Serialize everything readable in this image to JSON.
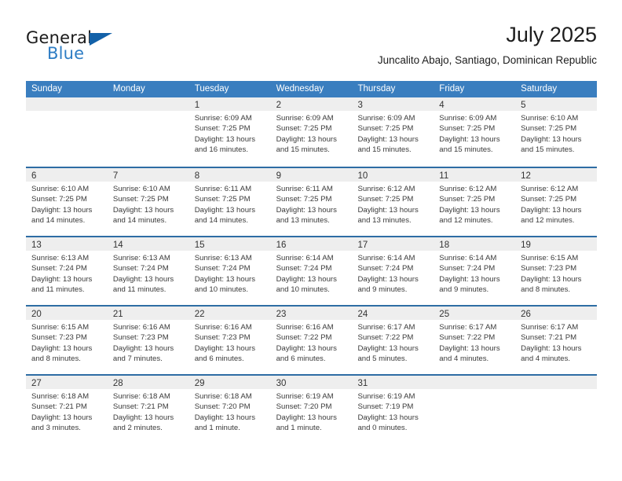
{
  "brand": {
    "name_part1": "General",
    "name_part2": "Blue",
    "flag_icon": "triangle-flag-icon"
  },
  "header": {
    "month_title": "July 2025",
    "location": "Juncalito Abajo, Santiago, Dominican Republic"
  },
  "colors": {
    "header_blue": "#3a7ebf",
    "week_divider_blue": "#2e6da4",
    "daynum_band": "#eeeeee",
    "brand_blue": "#2e7dc4",
    "flag_blue": "#1361a8"
  },
  "weekdays": [
    "Sunday",
    "Monday",
    "Tuesday",
    "Wednesday",
    "Thursday",
    "Friday",
    "Saturday"
  ],
  "weeks": [
    [
      {
        "day": "",
        "sunrise": "",
        "sunset": "",
        "daylight_line1": "",
        "daylight_line2": ""
      },
      {
        "day": "",
        "sunrise": "",
        "sunset": "",
        "daylight_line1": "",
        "daylight_line2": ""
      },
      {
        "day": "1",
        "sunrise": "Sunrise: 6:09 AM",
        "sunset": "Sunset: 7:25 PM",
        "daylight_line1": "Daylight: 13 hours",
        "daylight_line2": "and 16 minutes."
      },
      {
        "day": "2",
        "sunrise": "Sunrise: 6:09 AM",
        "sunset": "Sunset: 7:25 PM",
        "daylight_line1": "Daylight: 13 hours",
        "daylight_line2": "and 15 minutes."
      },
      {
        "day": "3",
        "sunrise": "Sunrise: 6:09 AM",
        "sunset": "Sunset: 7:25 PM",
        "daylight_line1": "Daylight: 13 hours",
        "daylight_line2": "and 15 minutes."
      },
      {
        "day": "4",
        "sunrise": "Sunrise: 6:09 AM",
        "sunset": "Sunset: 7:25 PM",
        "daylight_line1": "Daylight: 13 hours",
        "daylight_line2": "and 15 minutes."
      },
      {
        "day": "5",
        "sunrise": "Sunrise: 6:10 AM",
        "sunset": "Sunset: 7:25 PM",
        "daylight_line1": "Daylight: 13 hours",
        "daylight_line2": "and 15 minutes."
      }
    ],
    [
      {
        "day": "6",
        "sunrise": "Sunrise: 6:10 AM",
        "sunset": "Sunset: 7:25 PM",
        "daylight_line1": "Daylight: 13 hours",
        "daylight_line2": "and 14 minutes."
      },
      {
        "day": "7",
        "sunrise": "Sunrise: 6:10 AM",
        "sunset": "Sunset: 7:25 PM",
        "daylight_line1": "Daylight: 13 hours",
        "daylight_line2": "and 14 minutes."
      },
      {
        "day": "8",
        "sunrise": "Sunrise: 6:11 AM",
        "sunset": "Sunset: 7:25 PM",
        "daylight_line1": "Daylight: 13 hours",
        "daylight_line2": "and 14 minutes."
      },
      {
        "day": "9",
        "sunrise": "Sunrise: 6:11 AM",
        "sunset": "Sunset: 7:25 PM",
        "daylight_line1": "Daylight: 13 hours",
        "daylight_line2": "and 13 minutes."
      },
      {
        "day": "10",
        "sunrise": "Sunrise: 6:12 AM",
        "sunset": "Sunset: 7:25 PM",
        "daylight_line1": "Daylight: 13 hours",
        "daylight_line2": "and 13 minutes."
      },
      {
        "day": "11",
        "sunrise": "Sunrise: 6:12 AM",
        "sunset": "Sunset: 7:25 PM",
        "daylight_line1": "Daylight: 13 hours",
        "daylight_line2": "and 12 minutes."
      },
      {
        "day": "12",
        "sunrise": "Sunrise: 6:12 AM",
        "sunset": "Sunset: 7:25 PM",
        "daylight_line1": "Daylight: 13 hours",
        "daylight_line2": "and 12 minutes."
      }
    ],
    [
      {
        "day": "13",
        "sunrise": "Sunrise: 6:13 AM",
        "sunset": "Sunset: 7:24 PM",
        "daylight_line1": "Daylight: 13 hours",
        "daylight_line2": "and 11 minutes."
      },
      {
        "day": "14",
        "sunrise": "Sunrise: 6:13 AM",
        "sunset": "Sunset: 7:24 PM",
        "daylight_line1": "Daylight: 13 hours",
        "daylight_line2": "and 11 minutes."
      },
      {
        "day": "15",
        "sunrise": "Sunrise: 6:13 AM",
        "sunset": "Sunset: 7:24 PM",
        "daylight_line1": "Daylight: 13 hours",
        "daylight_line2": "and 10 minutes."
      },
      {
        "day": "16",
        "sunrise": "Sunrise: 6:14 AM",
        "sunset": "Sunset: 7:24 PM",
        "daylight_line1": "Daylight: 13 hours",
        "daylight_line2": "and 10 minutes."
      },
      {
        "day": "17",
        "sunrise": "Sunrise: 6:14 AM",
        "sunset": "Sunset: 7:24 PM",
        "daylight_line1": "Daylight: 13 hours",
        "daylight_line2": "and 9 minutes."
      },
      {
        "day": "18",
        "sunrise": "Sunrise: 6:14 AM",
        "sunset": "Sunset: 7:24 PM",
        "daylight_line1": "Daylight: 13 hours",
        "daylight_line2": "and 9 minutes."
      },
      {
        "day": "19",
        "sunrise": "Sunrise: 6:15 AM",
        "sunset": "Sunset: 7:23 PM",
        "daylight_line1": "Daylight: 13 hours",
        "daylight_line2": "and 8 minutes."
      }
    ],
    [
      {
        "day": "20",
        "sunrise": "Sunrise: 6:15 AM",
        "sunset": "Sunset: 7:23 PM",
        "daylight_line1": "Daylight: 13 hours",
        "daylight_line2": "and 8 minutes."
      },
      {
        "day": "21",
        "sunrise": "Sunrise: 6:16 AM",
        "sunset": "Sunset: 7:23 PM",
        "daylight_line1": "Daylight: 13 hours",
        "daylight_line2": "and 7 minutes."
      },
      {
        "day": "22",
        "sunrise": "Sunrise: 6:16 AM",
        "sunset": "Sunset: 7:23 PM",
        "daylight_line1": "Daylight: 13 hours",
        "daylight_line2": "and 6 minutes."
      },
      {
        "day": "23",
        "sunrise": "Sunrise: 6:16 AM",
        "sunset": "Sunset: 7:22 PM",
        "daylight_line1": "Daylight: 13 hours",
        "daylight_line2": "and 6 minutes."
      },
      {
        "day": "24",
        "sunrise": "Sunrise: 6:17 AM",
        "sunset": "Sunset: 7:22 PM",
        "daylight_line1": "Daylight: 13 hours",
        "daylight_line2": "and 5 minutes."
      },
      {
        "day": "25",
        "sunrise": "Sunrise: 6:17 AM",
        "sunset": "Sunset: 7:22 PM",
        "daylight_line1": "Daylight: 13 hours",
        "daylight_line2": "and 4 minutes."
      },
      {
        "day": "26",
        "sunrise": "Sunrise: 6:17 AM",
        "sunset": "Sunset: 7:21 PM",
        "daylight_line1": "Daylight: 13 hours",
        "daylight_line2": "and 4 minutes."
      }
    ],
    [
      {
        "day": "27",
        "sunrise": "Sunrise: 6:18 AM",
        "sunset": "Sunset: 7:21 PM",
        "daylight_line1": "Daylight: 13 hours",
        "daylight_line2": "and 3 minutes."
      },
      {
        "day": "28",
        "sunrise": "Sunrise: 6:18 AM",
        "sunset": "Sunset: 7:21 PM",
        "daylight_line1": "Daylight: 13 hours",
        "daylight_line2": "and 2 minutes."
      },
      {
        "day": "29",
        "sunrise": "Sunrise: 6:18 AM",
        "sunset": "Sunset: 7:20 PM",
        "daylight_line1": "Daylight: 13 hours",
        "daylight_line2": "and 1 minute."
      },
      {
        "day": "30",
        "sunrise": "Sunrise: 6:19 AM",
        "sunset": "Sunset: 7:20 PM",
        "daylight_line1": "Daylight: 13 hours",
        "daylight_line2": "and 1 minute."
      },
      {
        "day": "31",
        "sunrise": "Sunrise: 6:19 AM",
        "sunset": "Sunset: 7:19 PM",
        "daylight_line1": "Daylight: 13 hours",
        "daylight_line2": "and 0 minutes."
      },
      {
        "day": "",
        "sunrise": "",
        "sunset": "",
        "daylight_line1": "",
        "daylight_line2": ""
      },
      {
        "day": "",
        "sunrise": "",
        "sunset": "",
        "daylight_line1": "",
        "daylight_line2": ""
      }
    ]
  ]
}
